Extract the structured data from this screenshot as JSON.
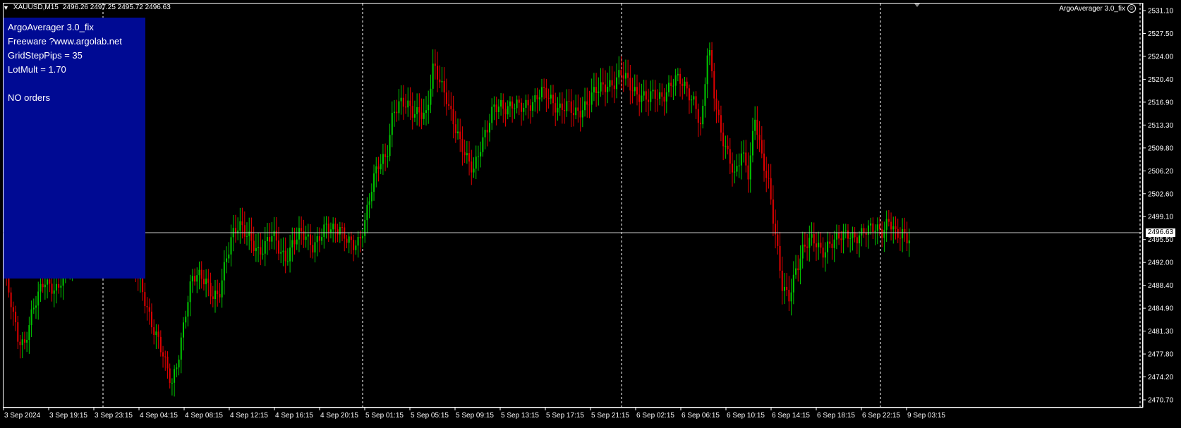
{
  "header": {
    "symbol_tf": "XAUUSD,M15",
    "ohlc": "2496.26 2497.25 2495.72 2496.63"
  },
  "ea_name": "ArgoAverager 3.0_fix",
  "panel": {
    "lines": [
      "ArgoAverager 3.0_fix",
      "Freeware ?www.argolab.net",
      "GridStepPips = 35",
      "LotMult = 1.70",
      "",
      "NO orders"
    ]
  },
  "current_price": "2496.63",
  "colors": {
    "bg": "#000000",
    "bull": "#00c800",
    "bear": "#e00000",
    "panel": "#000a93",
    "axis": "#ffffff",
    "grid": "#ffffff"
  },
  "y_axis": {
    "labels": [
      "2531.10",
      "2527.50",
      "2524.00",
      "2520.40",
      "2516.90",
      "2513.30",
      "2509.80",
      "2506.20",
      "2502.60",
      "2499.10",
      "2495.50",
      "2492.00",
      "2488.40",
      "2484.90",
      "2481.30",
      "2477.80",
      "2474.20",
      "2470.70"
    ]
  },
  "x_axis": {
    "labels": [
      "3 Sep 2024",
      "3 Sep 19:15",
      "3 Sep 23:15",
      "4 Sep 04:15",
      "4 Sep 08:15",
      "4 Sep 12:15",
      "4 Sep 16:15",
      "4 Sep 20:15",
      "5 Sep 01:15",
      "5 Sep 05:15",
      "5 Sep 09:15",
      "5 Sep 13:15",
      "5 Sep 17:15",
      "5 Sep 21:15",
      "6 Sep 02:15",
      "6 Sep 06:15",
      "6 Sep 10:15",
      "6 Sep 14:15",
      "6 Sep 18:15",
      "6 Sep 22:15",
      "9 Sep 03:15"
    ]
  },
  "chart_data": {
    "type": "candlestick",
    "ylim": [
      2470.7,
      2531.1
    ],
    "closes": [
      2490,
      2486,
      2481,
      2479,
      2483,
      2487,
      2490,
      2488,
      2487,
      2491,
      2493,
      2496,
      2496,
      2496,
      2496,
      2496,
      2497,
      2497,
      2495,
      2492,
      2489,
      2486,
      2483,
      2480,
      2476,
      2473,
      2478,
      2484,
      2489,
      2490,
      2490,
      2487,
      2486,
      2492,
      2497,
      2498,
      2496,
      2495,
      2494,
      2495,
      2496,
      2494,
      2493,
      2495,
      2496,
      2496,
      2495,
      2496,
      2497,
      2497,
      2498,
      2496,
      2494,
      2495,
      2500,
      2505,
      2507,
      2508,
      2516,
      2517,
      2516,
      2515,
      2516,
      2515,
      2522,
      2520,
      2518,
      2514,
      2510,
      2508,
      2507,
      2510,
      2512,
      2516,
      2517,
      2516,
      2516,
      2516,
      2517,
      2517,
      2518,
      2518,
      2517,
      2516,
      2516,
      2515,
      2516,
      2517,
      2518,
      2519,
      2520,
      2520,
      2521,
      2520,
      2519,
      2518,
      2517,
      2518,
      2518,
      2519,
      2520,
      2520,
      2519,
      2517,
      2512,
      2526,
      2518,
      2512,
      2508,
      2505,
      2510,
      2506,
      2514,
      2508,
      2505,
      2497,
      2488,
      2486,
      2491,
      2494,
      2495,
      2495,
      2494,
      2495,
      2495,
      2496,
      2497,
      2496,
      2496,
      2497,
      2498,
      2497,
      2498,
      2496,
      2497,
      2496
    ]
  }
}
